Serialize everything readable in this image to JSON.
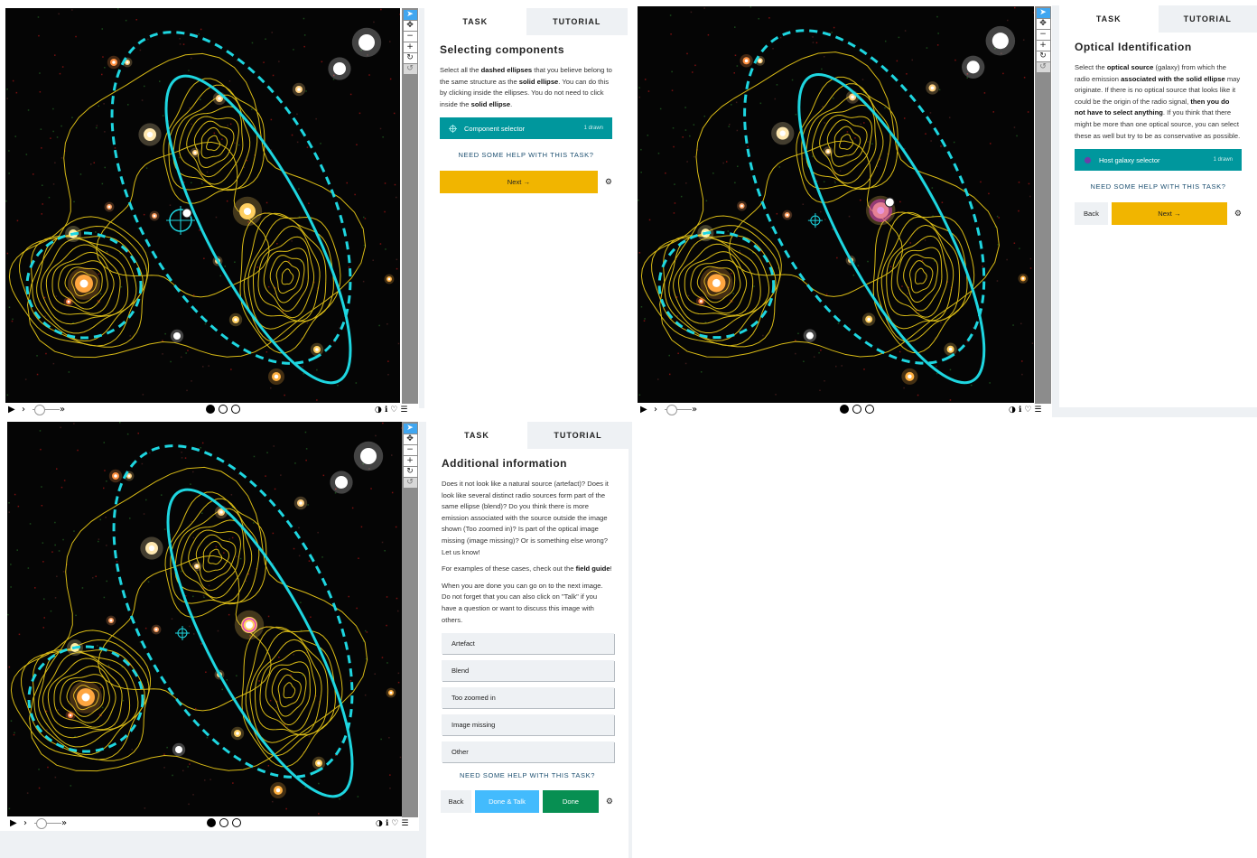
{
  "toolbar": {
    "pointer": "pointer-icon",
    "move": "move-icon",
    "zoom_out": "zoom-out-icon",
    "zoom_in": "zoom-in-icon",
    "rotate": "rotate-icon",
    "reset": "reset-icon"
  },
  "panels": [
    {
      "tabs": {
        "task": "TASK",
        "tutorial": "TUTORIAL"
      },
      "title": "Selecting components",
      "selector": {
        "label": "Component selector",
        "count": "1 drawn",
        "icon": "crosshair-icon",
        "color": "#00979d"
      },
      "help": "NEED SOME HELP WITH THIS TASK?",
      "next": "Next →"
    },
    {
      "tabs": {
        "task": "TASK",
        "tutorial": "TUTORIAL"
      },
      "title": "Optical Identification",
      "selector": {
        "label": "Host galaxy selector",
        "count": "1 drawn",
        "icon": "dot-icon",
        "color": "#00979d"
      },
      "help": "NEED SOME HELP WITH THIS TASK?",
      "back": "Back",
      "next": "Next →"
    },
    {
      "tabs": {
        "task": "TASK",
        "tutorial": "TUTORIAL"
      },
      "title": "Additional information",
      "options": [
        "Artefact",
        "Blend",
        "Too zoomed in",
        "Image missing",
        "Other"
      ],
      "help": "NEED SOME HELP WITH THIS TASK?",
      "back": "Back",
      "done_talk": "Done & Talk",
      "done": "Done"
    }
  ],
  "colors": {
    "accent": "#00979d",
    "next": "#f1b500",
    "done": "#078f52",
    "done_talk": "#43bbfd",
    "ellipse": "#1ed6e0",
    "contour": "#e3c21a"
  }
}
